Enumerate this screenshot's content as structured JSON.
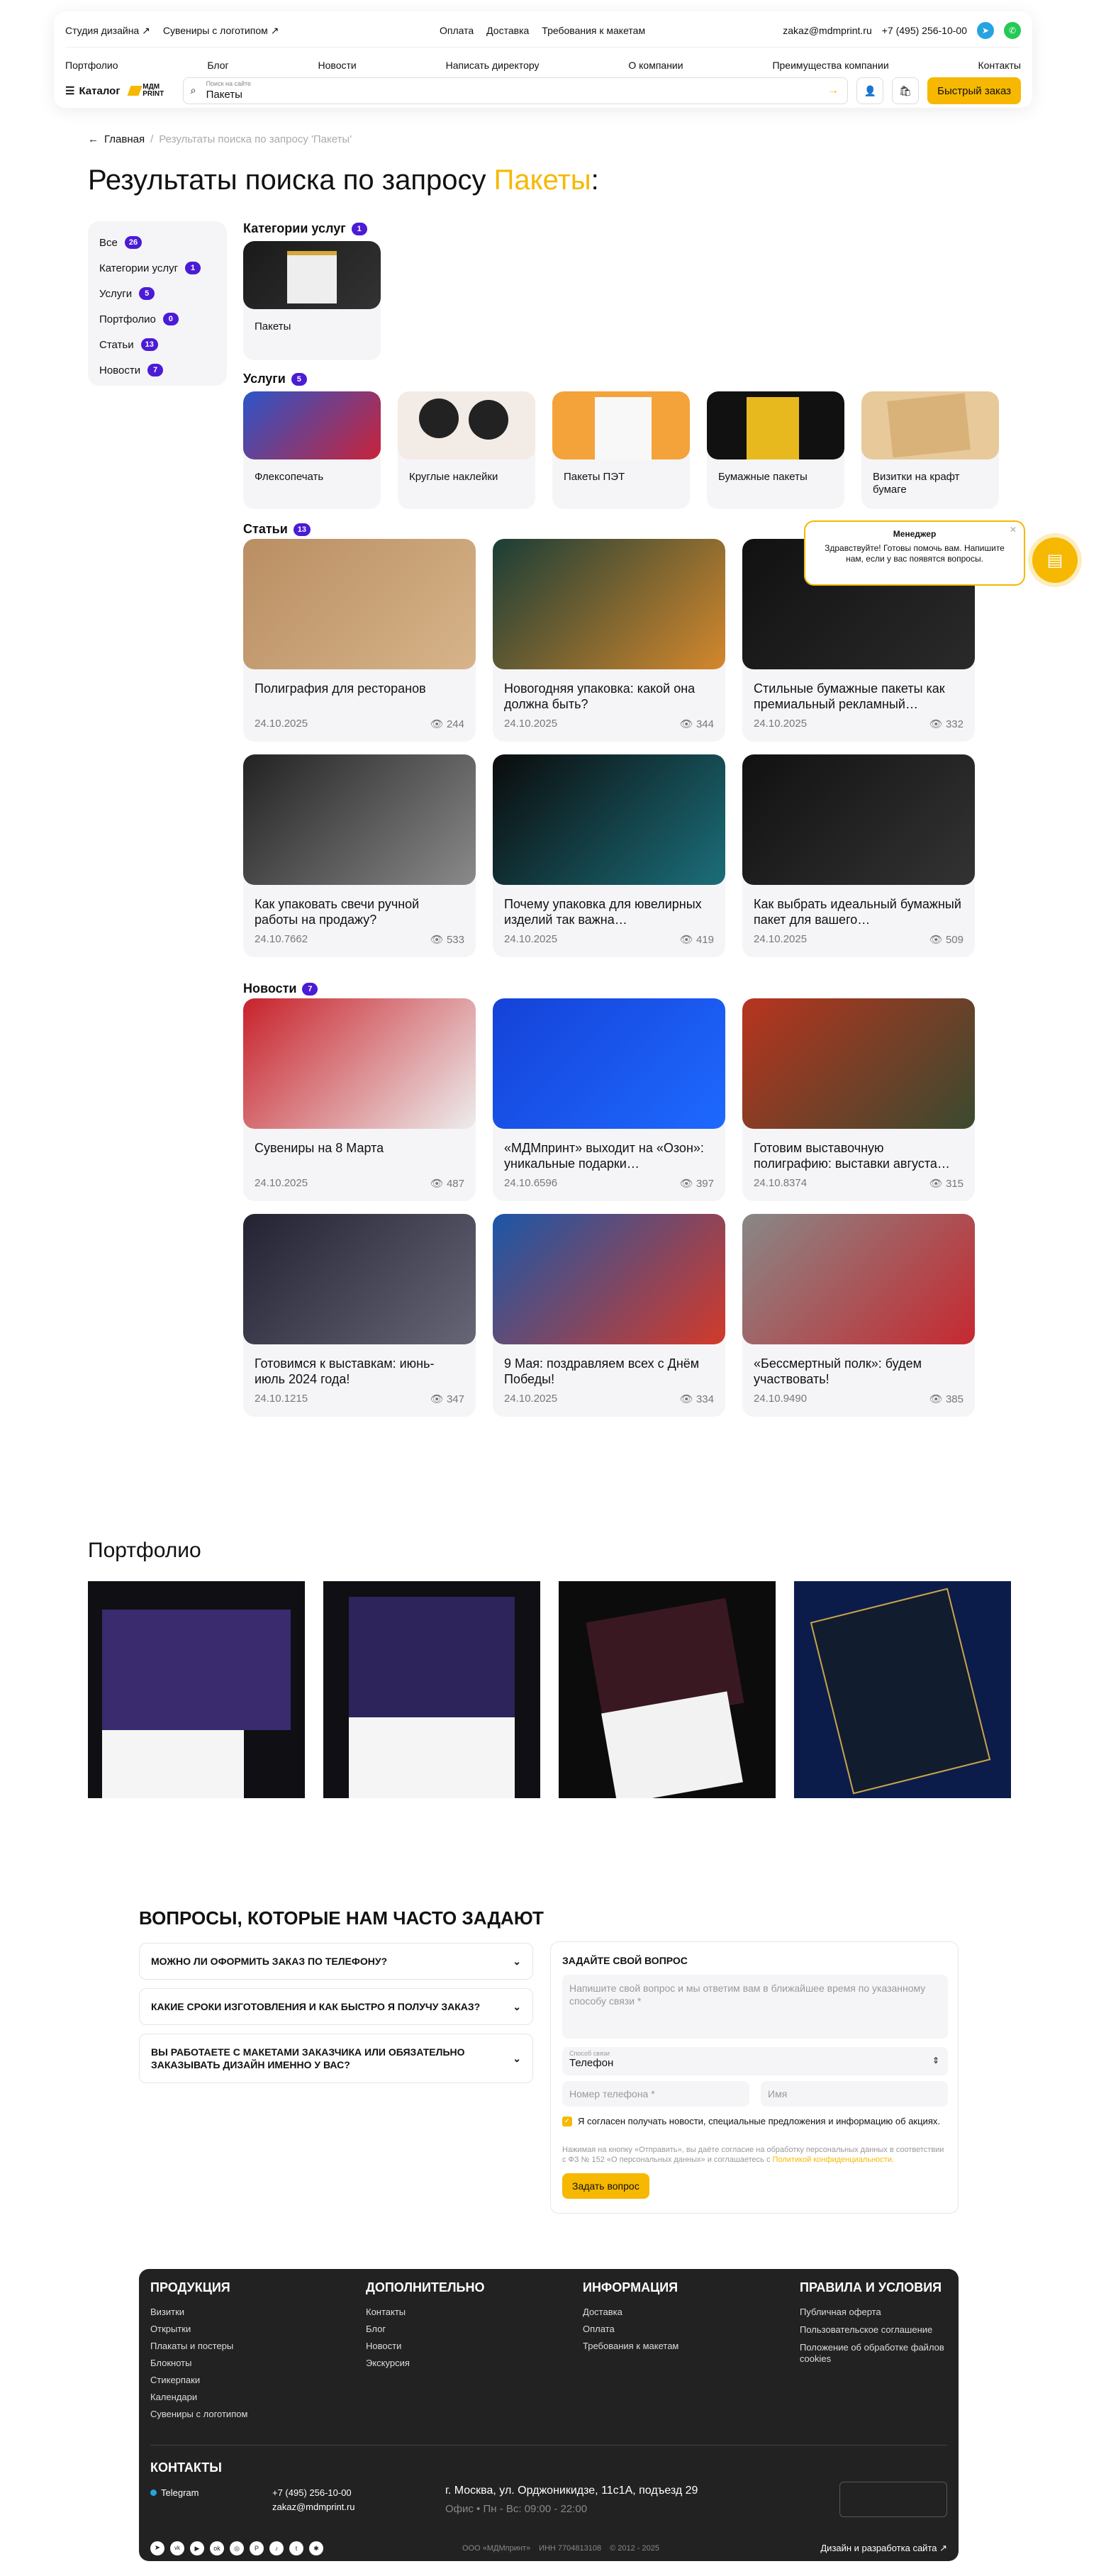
{
  "header": {
    "studio": "Студия дизайна ↗",
    "souvenirs": "Сувениры с логотипом ↗",
    "pay": "Оплата",
    "delivery": "Доставка",
    "req": "Требования к макетам",
    "email": "zakaz@mdmprint.ru",
    "phone": "+7 (495) 256-10-00",
    "nav": [
      "Портфолио",
      "Блог",
      "Новости",
      "Написать директору",
      "О компании",
      "Преимущества компании",
      "Контакты"
    ],
    "catalog": "Каталог",
    "logo": "МДМ PRINT",
    "search_label": "Поиск на сайте",
    "search_value": "Пакеты",
    "quick": "Быстрый заказ"
  },
  "breadcrumb": {
    "home": "Главная",
    "current": "Результаты поиска по запросу 'Пакеты'"
  },
  "title": {
    "prefix": "Результаты поиска по запросу ",
    "query": "Пакеты",
    "suffix": ":"
  },
  "sidebar": [
    {
      "label": "Все",
      "count": "26"
    },
    {
      "label": "Категории услуг",
      "count": "1"
    },
    {
      "label": "Услуги",
      "count": "5"
    },
    {
      "label": "Портфолио",
      "count": "0"
    },
    {
      "label": "Статьи",
      "count": "13"
    },
    {
      "label": "Новости",
      "count": "7"
    }
  ],
  "sections": {
    "categories": {
      "label": "Категории услуг",
      "count": "1"
    },
    "services": {
      "label": "Услуги",
      "count": "5"
    },
    "articles": {
      "label": "Статьи",
      "count": "13"
    },
    "news": {
      "label": "Новости",
      "count": "7"
    }
  },
  "category": {
    "title": "Пакеты"
  },
  "services": [
    "Флексопечать",
    "Круглые наклейки",
    "Пакеты ПЭТ",
    "Бумажные пакеты",
    "Визитки на крафт бумаге"
  ],
  "articles": [
    {
      "t": "Полиграфия для ресторанов",
      "d": "24.10.2025",
      "v": "244"
    },
    {
      "t": "Новогодняя упаковка: какой она должна быть?",
      "d": "24.10.2025",
      "v": "344"
    },
    {
      "t": "Стильные бумажные пакеты как премиальный рекламный…",
      "d": "24.10.2025",
      "v": "332"
    },
    {
      "t": "Как упаковать свечи ручной работы на продажу?",
      "d": "24.10.7662",
      "v": "533"
    },
    {
      "t": "Почему упаковка для ювелирных изделий так важна…",
      "d": "24.10.2025",
      "v": "419"
    },
    {
      "t": "Как выбрать идеальный бумажный пакет для вашего…",
      "d": "24.10.2025",
      "v": "509"
    }
  ],
  "news": [
    {
      "t": "Сувениры на 8 Марта",
      "d": "24.10.2025",
      "v": "487"
    },
    {
      "t": "«МДМпринт» выходит на «Озон»: уникальные подарки…",
      "d": "24.10.6596",
      "v": "397"
    },
    {
      "t": "Готовим выставочную полиграфию: выставки августа…",
      "d": "24.10.8374",
      "v": "315"
    },
    {
      "t": "Готовимся к выставкам: июнь-июль 2024 года!",
      "d": "24.10.1215",
      "v": "347"
    },
    {
      "t": "9 Мая: поздравляем всех с Днём Победы!",
      "d": "24.10.2025",
      "v": "334"
    },
    {
      "t": "«Бессмертный полк»: будем участвовать!",
      "d": "24.10.9490",
      "v": "385"
    }
  ],
  "chat": {
    "name": "Менеджер",
    "text": "Здравствуйте! Готовы помочь вам. Напишите нам, если у вас появятся вопросы."
  },
  "portfolio": {
    "title": "Портфолио"
  },
  "faq": {
    "title": "ВОПРОСЫ, КОТОРЫЕ НАМ ЧАСТО ЗАДАЮТ",
    "items": [
      "Можно ли оформить заказ по телефону?",
      "Какие сроки изготовления и как быстро я получу заказ?",
      "Вы работаете с макетами заказчика или обязательно заказывать дизайн именно у вас?"
    ]
  },
  "form": {
    "title": "ЗАДАЙТЕ СВОЙ ВОПРОС",
    "q_ph": "Напишите свой вопрос и мы ответим вам в ближайшее время по указанному способу связи *",
    "method_label": "Способ связи",
    "method": "Телефон",
    "phone_ph": "Номер телефона *",
    "name_ph": "Имя",
    "consent": "Я согласен получать новости, специальные предложения и информацию об акциях.",
    "legal": "Нажимая на кнопку «Отправить», вы даёте согласие на обработку персональных данных в соответствии с ФЗ № 152 «О персональных данных» и соглашаетесь с",
    "legal_link": "Политикой конфиденциальности.",
    "submit": "Задать вопрос"
  },
  "footer": {
    "cols": [
      {
        "h": "ПРОДУКЦИЯ",
        "items": [
          "Визитки",
          "Открытки",
          "Плакаты и постеры",
          "Блокноты",
          "Стикерпаки",
          "Календари",
          "Сувениры с логотипом"
        ]
      },
      {
        "h": "ДОПОЛНИТЕЛЬНО",
        "items": [
          "Контакты",
          "Блог",
          "Новости",
          "Экскурсия"
        ]
      },
      {
        "h": "ИНФОРМАЦИЯ",
        "items": [
          "Доставка",
          "Оплата",
          "Требования к макетам"
        ]
      },
      {
        "h": "ПРАВИЛА И УСЛОВИЯ",
        "items": [
          "Публичная оферта",
          "Пользовательское соглашение",
          "Положение об обработке файлов cookies"
        ]
      }
    ],
    "contacts": "КОНТАКТЫ",
    "telegram": "Telegram",
    "phone": "+7 (495) 256-10-00",
    "email": "zakaz@mdmprint.ru",
    "address": "г. Москва, ул. Орджоникидзе, 11с1А, подъезд 29",
    "hours": "Офис • Пн - Вс: 09:00 - 22:00",
    "company": "ООО «МДМпринт»",
    "inn": "ИНН 7704813108",
    "years": "© 2012 - 2025",
    "dev": "Дизайн и разработка сайта ↗"
  },
  "colors": {
    "accent": "#f6b800",
    "badge": "#4b1bd6",
    "footer": "#222222"
  }
}
